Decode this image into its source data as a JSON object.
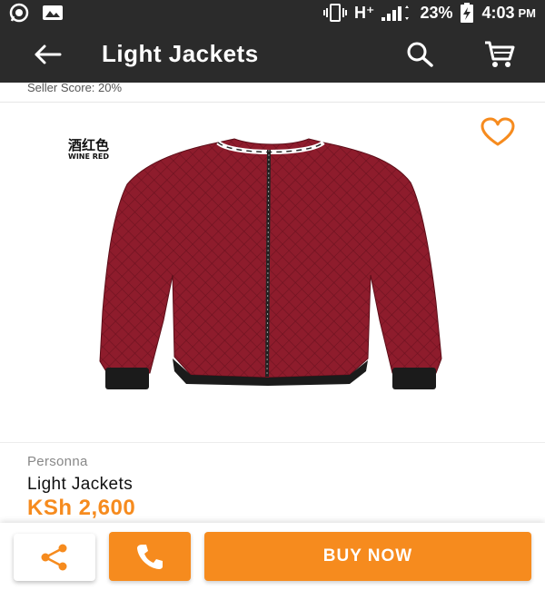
{
  "status_bar": {
    "network": "H⁺",
    "battery": "23%",
    "time": "4:03",
    "ampm": "PM",
    "icons": [
      "whatsapp-icon",
      "gallery-icon",
      "vibrate-icon",
      "signal-icon",
      "battery-charging-icon"
    ]
  },
  "app_bar": {
    "title": "Light Jackets",
    "icons": [
      "back-arrow-icon",
      "search-icon",
      "cart-icon"
    ]
  },
  "seller": {
    "text": "Seller Score: 20%"
  },
  "product": {
    "image_label_cn": "酒红色",
    "image_label_en": "WINE RED",
    "brand": "Personna",
    "name": "Light Jackets",
    "price": "KSh 2,600"
  },
  "actions": {
    "buy_label": "BUY NOW",
    "icons": [
      "share-icon",
      "phone-icon",
      "heart-outline-icon"
    ]
  },
  "colors": {
    "bar": "#2b2b2b",
    "accent": "#f68b1e",
    "jacket": "#8e1c2c"
  }
}
